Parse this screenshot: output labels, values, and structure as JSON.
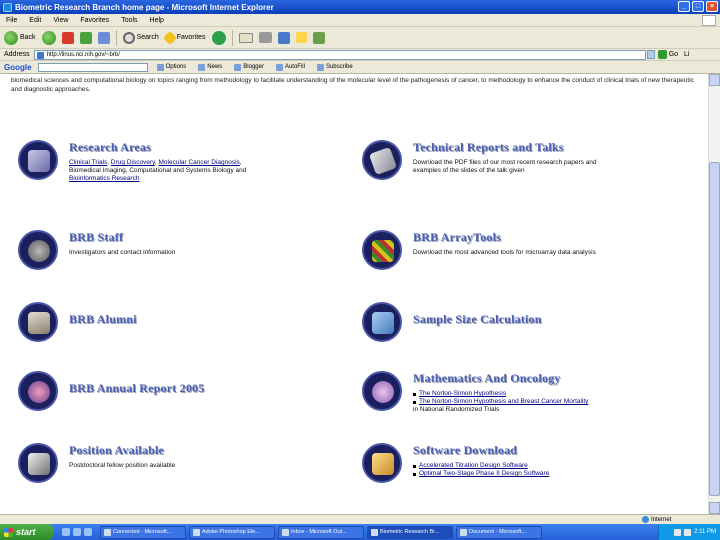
{
  "window": {
    "title": "Biometric Research Branch home page - Microsoft Internet Explorer",
    "controls": [
      "_",
      "□",
      "×"
    ]
  },
  "menu": [
    "File",
    "Edit",
    "View",
    "Favorites",
    "Tools",
    "Help"
  ],
  "toolbar": {
    "back": "Back",
    "search": "Search",
    "favorites": "Favorites"
  },
  "address": {
    "label": "Address",
    "value": "http://linus.nci.nih.gov/~brb/",
    "go": "Go",
    "links": "Li"
  },
  "google": {
    "logo": "Google",
    "search_value": "",
    "buttons": [
      "Options",
      "News",
      "Blogger",
      "AutoFill",
      "Subscribe"
    ]
  },
  "intro": "biomedical sciences and computational biology on topics ranging from methodology to facilitate understanding of the molecular level of the pathogenesis of cancer, to methodology to enhance the conduct of clinical trials of new therapeutic and diagnostic approaches.",
  "sections": {
    "research": {
      "title": "Research Areas",
      "links": [
        "Clinical Trials",
        "Drug Discovery",
        "Molecular Cancer Diagnosis"
      ],
      "desc": "Biomedical Imaging, Computational and Systems Biology and ",
      "desc_link": "Bioinformatics Research"
    },
    "reports": {
      "title": "Technical Reports and Talks",
      "desc": "Download the PDF files of our most recent research papers and examples of the slides of the talk given"
    },
    "staff": {
      "title": "BRB Staff",
      "desc": "Investigators and contact information"
    },
    "arraytools": {
      "title": "BRB ArrayTools",
      "desc": "Download the most advanced tools for microarray data analysis"
    },
    "alumni": {
      "title": "BRB Alumni"
    },
    "samplesize": {
      "title": "Sample Size Calculation"
    },
    "annual": {
      "title": "BRB Annual Report 2005"
    },
    "math": {
      "title": "Mathematics And Oncology",
      "items": [
        "The Norton-Simon Hypothesis",
        "The Norton-Simon Hypothesis and Breast Cancer Mortality"
      ],
      "desc": "in National Randomized Trials"
    },
    "position": {
      "title": "Position Available",
      "desc": "Postdoctoral fellow position available"
    },
    "software": {
      "title": "Software Download",
      "items": [
        "Accelerated Titration Design Software",
        "Optimal Two-Stage Phase II Design Software"
      ]
    }
  },
  "status": {
    "zone": "Internet"
  },
  "taskbar": {
    "start": "start",
    "tasks": [
      "Connected - Microsoft...",
      "Adobe Photoshop Ele...",
      "Inbox - Microsoft Out...",
      "Biometric Research Br...",
      "Document - Microsoft..."
    ],
    "clock": "2:11 PM"
  },
  "colors": {
    "heading": "#4a5fb0",
    "icon_bg": "#1a1f5e",
    "link": "#000080"
  }
}
